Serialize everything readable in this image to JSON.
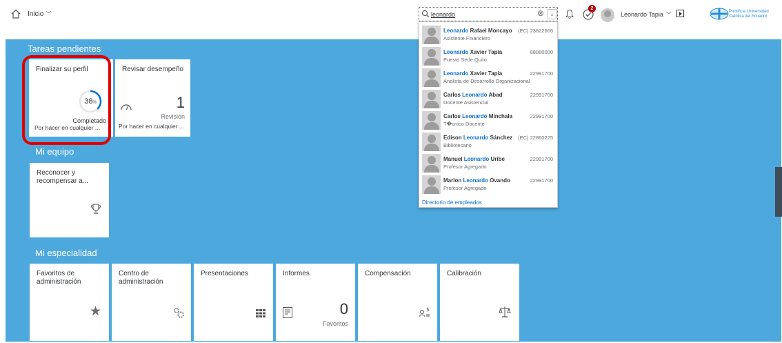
{
  "header": {
    "home_menu": "Inicio",
    "search_value": "leonardo",
    "notifications_badge": "2",
    "user_name": "Leonardo Tapia",
    "logo_line1": "Pontificia Universidad",
    "logo_line2": "Católica del Ecuador"
  },
  "sections": {
    "pending": "Tareas pendientes",
    "team": "Mi equipo",
    "specialty": "Mi especialidad"
  },
  "tiles": {
    "profile": {
      "title": "Finalizar su perfil",
      "percent": "38",
      "percent_unit": "%",
      "progress_fraction": 0.38,
      "status": "Completado",
      "footer": "Por hacer en cualquier ..."
    },
    "review": {
      "title": "Revisar desempeño",
      "count": "1",
      "unit": "Revisión",
      "footer": "Por hacer en cualquier ..."
    },
    "recognize": {
      "title": "Reconocer y recompensar a..."
    },
    "admin_fav": {
      "title": "Favoritos de administración"
    },
    "admin_center": {
      "title": "Centro de administración"
    },
    "presentations": {
      "title": "Presentaciones"
    },
    "reports": {
      "title": "Informes",
      "count": "0",
      "unit": "Favoritos"
    },
    "compensation": {
      "title": "Compensación"
    },
    "calibration": {
      "title": "Calibración"
    }
  },
  "dropdown": {
    "results": [
      {
        "highlight": "Leonardo",
        "rest": " Rafael Moncayo",
        "title": "Asistente Financiero",
        "id": "(EC) 23822666"
      },
      {
        "highlight": "Leonardo",
        "rest": " Xavier Tapia",
        "title": "Puesto Sede Quito",
        "id": "88880000"
      },
      {
        "highlight": "Leonardo",
        "rest": " Xavier Tapia",
        "title": "Analista de Desarrollo Organizacional",
        "id": "22991700"
      },
      {
        "pre": "Carlos ",
        "highlight": "Leonardo",
        "rest": " Abad",
        "title": "Docente Asistencial",
        "id": "22991700"
      },
      {
        "pre": "Carlos ",
        "highlight": "Leonardo",
        "rest": " Minchala",
        "title": "T�cnico Docente",
        "id": "22991700"
      },
      {
        "pre": "Edison ",
        "highlight": "Leonardo",
        "rest": " Sánchez",
        "title": "Bibliotecario",
        "id": "(EC) 22860225"
      },
      {
        "pre": "Manuel ",
        "highlight": "Leonardo",
        "rest": " Uribe",
        "title": "Profesor Agregado",
        "id": "22991700"
      },
      {
        "pre": "Marlon ",
        "highlight": "Leonardo",
        "rest": " Ovando",
        "title": "Profesor Agregado",
        "id": "22991700"
      }
    ],
    "footer_link": "Directorio de empleados"
  },
  "colors": {
    "main_bg": "#4da8dd",
    "accent": "#0a6ed1",
    "highlight_ring": "#e00000",
    "badge": "#bb0000"
  }
}
